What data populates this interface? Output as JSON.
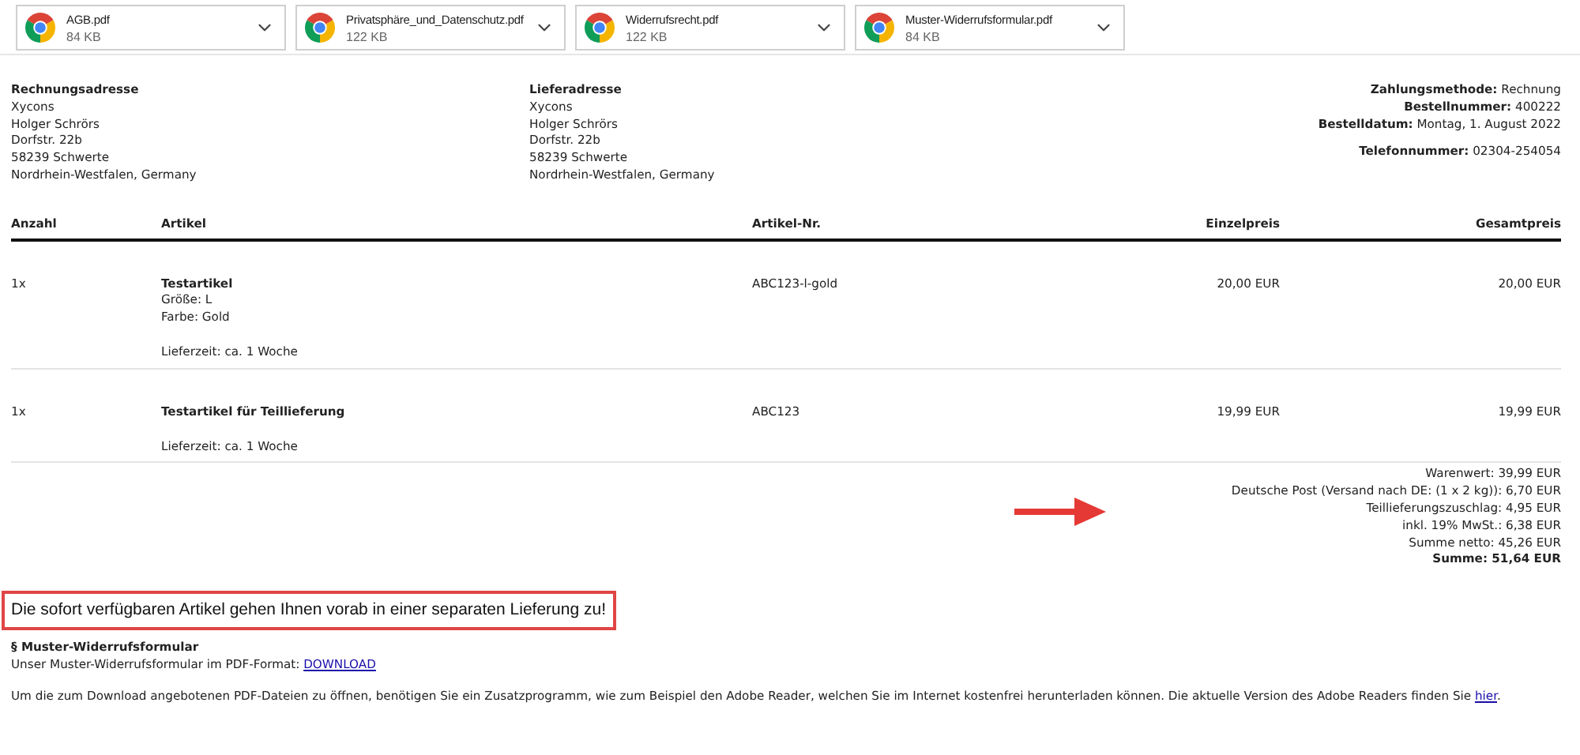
{
  "downloads": [
    {
      "name": "AGB.pdf",
      "size": "84 KB"
    },
    {
      "name": "Privatsphäre_und_Datenschutz.pdf",
      "size": "122 KB"
    },
    {
      "name": "Widerrufsrecht.pdf",
      "size": "122 KB"
    },
    {
      "name": "Muster-Widerrufsformular.pdf",
      "size": "84 KB"
    }
  ],
  "billing": {
    "title": "Rechnungsadresse",
    "lines": [
      "Xycons",
      "Holger Schrörs",
      "Dorfstr. 22b",
      "58239 Schwerte",
      "Nordrhein-Westfalen, Germany"
    ]
  },
  "shipping": {
    "title": "Lieferadresse",
    "lines": [
      "Xycons",
      "Holger Schrörs",
      "Dorfstr. 22b",
      "58239 Schwerte",
      "Nordrhein-Westfalen, Germany"
    ]
  },
  "order_info": [
    "**Zahlungsmethode:** Rechnung",
    "**Bestellnummer:** 400222",
    "**Bestelldatum:** Montag, 1. August 2022"
  ],
  "phone": "**Telefonnummer:** 02304-254054",
  "table": {
    "columns": [
      "Anzahl",
      "Artikel",
      "Artikel-Nr.",
      "Einzelpreis",
      "Gesamtpreis"
    ],
    "rows": [
      {
        "qty": "1x",
        "name": "Testartikel",
        "attributes": [
          "Größe: L",
          "Farbe: Gold"
        ],
        "delivery": "Lieferzeit: ca. 1 Woche",
        "sku": "ABC123-l-gold",
        "unit_price": "20,00 EUR",
        "total": "20,00 EUR"
      },
      {
        "qty": "1x",
        "name": "Testartikel für Teillieferung",
        "attributes": [],
        "delivery": "Lieferzeit: ca. 1 Woche",
        "sku": "ABC123",
        "unit_price": "19,99 EUR",
        "total": "19,99 EUR"
      }
    ]
  },
  "summary": [
    {
      "text": "Warenwert: 39,99 EUR",
      "kind": "line"
    },
    {
      "text": "Deutsche Post (Versand nach DE: (1 x 2 kg)): 6,70 EUR",
      "kind": "line"
    },
    {
      "text": "Teillieferungszuschlag: 4,95 EUR",
      "kind": "line"
    },
    {
      "text": "inkl. 19% MwSt.: 6,38 EUR",
      "kind": "line"
    },
    {
      "text": "Summe netto: 45,26 EUR",
      "kind": "line"
    },
    {
      "text": "Summe: 51,64 EUR",
      "kind": "total"
    }
  ],
  "notice": "Die sofort verfügbaren Artikel gehen Ihnen vorab in einer separaten Lieferung zu!",
  "form_section": {
    "title": "§ Muster-Widerrufsformular",
    "text": "Unser Muster-Widerrufsformular im PDF-Format: ",
    "link": "DOWNLOAD"
  },
  "info": {
    "text": "Um die zum Download angebotenen PDF-Dateien zu öffnen, benötigen Sie ein Zusatzprogramm, wie zum Beispiel den Adobe Reader, welchen Sie im Internet kostenfrei herunterladen können. Die aktuelle Version des Adobe Readers finden Sie ",
    "link": "hier",
    "after": "."
  }
}
